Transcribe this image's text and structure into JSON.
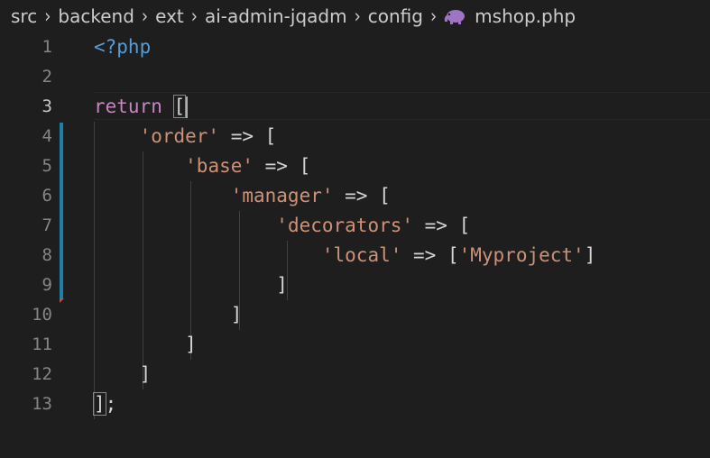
{
  "breadcrumb": {
    "items": [
      "src",
      "backend",
      "ext",
      "ai-admin-jqadm",
      "config"
    ],
    "file_icon": "php-elephant-icon",
    "file_name": "mshop.php"
  },
  "editor": {
    "active_line": 3,
    "line_numbers": [
      "1",
      "2",
      "3",
      "4",
      "5",
      "6",
      "7",
      "8",
      "9",
      "10",
      "11",
      "12",
      "13"
    ],
    "lines": [
      [
        {
          "t": "tag",
          "v": "<?php"
        }
      ],
      [],
      [
        {
          "t": "kw",
          "v": "return"
        },
        {
          "t": "op",
          "v": " "
        },
        {
          "t": "op",
          "v": "[",
          "cursor": true
        }
      ],
      [
        {
          "t": "op",
          "v": "    "
        },
        {
          "t": "str",
          "v": "'order'"
        },
        {
          "t": "op",
          "v": " => ["
        }
      ],
      [
        {
          "t": "op",
          "v": "        "
        },
        {
          "t": "str",
          "v": "'base'"
        },
        {
          "t": "op",
          "v": " => ["
        }
      ],
      [
        {
          "t": "op",
          "v": "            "
        },
        {
          "t": "str",
          "v": "'manager'"
        },
        {
          "t": "op",
          "v": " => ["
        }
      ],
      [
        {
          "t": "op",
          "v": "                "
        },
        {
          "t": "str",
          "v": "'decorators'"
        },
        {
          "t": "op",
          "v": " => ["
        }
      ],
      [
        {
          "t": "op",
          "v": "                    "
        },
        {
          "t": "str",
          "v": "'local'"
        },
        {
          "t": "op",
          "v": " => ["
        },
        {
          "t": "str",
          "v": "'Myproject'"
        },
        {
          "t": "op",
          "v": "]"
        }
      ],
      [
        {
          "t": "op",
          "v": "                ]"
        }
      ],
      [
        {
          "t": "op",
          "v": "            ]"
        }
      ],
      [
        {
          "t": "op",
          "v": "        ]"
        }
      ],
      [
        {
          "t": "op",
          "v": "    ]"
        }
      ],
      [
        {
          "t": "op",
          "v": "]",
          "match": true
        },
        {
          "t": "op",
          "v": ";"
        }
      ]
    ]
  },
  "colors": {
    "background": "#1e1e1e",
    "php_tag": "#569cd6",
    "keyword": "#c586c0",
    "string": "#ce9178",
    "default_text": "#d4d4d4",
    "line_number": "#858585",
    "active_line_number": "#c6c6c6",
    "modified_gutter": "#1b81a8",
    "deleted_gutter": "#c74e39"
  }
}
